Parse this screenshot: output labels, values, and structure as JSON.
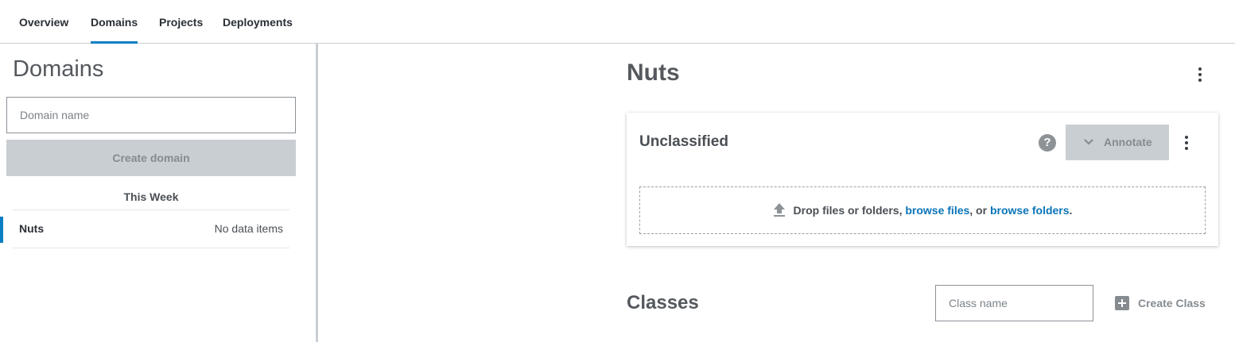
{
  "nav": {
    "tabs": [
      {
        "label": "Overview",
        "active": false
      },
      {
        "label": "Domains",
        "active": true
      },
      {
        "label": "Projects",
        "active": false
      },
      {
        "label": "Deployments",
        "active": false
      }
    ]
  },
  "sidebar": {
    "title": "Domains",
    "domain_input": {
      "placeholder": "Domain name",
      "value": ""
    },
    "create_button_label": "Create domain",
    "group_label": "This Week",
    "domains": [
      {
        "name": "Nuts",
        "meta": "No data items",
        "selected": true
      }
    ]
  },
  "main": {
    "title": "Nuts",
    "unclassified_card": {
      "title": "Unclassified",
      "help_icon_glyph": "?",
      "annotate_label": "Annotate",
      "dropzone": {
        "text_prefix": "Drop files or folders, ",
        "browse_files": "browse files",
        "text_middle": ", or ",
        "browse_folders": "browse folders",
        "text_suffix": "."
      }
    },
    "classes": {
      "title": "Classes",
      "input": {
        "placeholder": "Class name",
        "value": ""
      },
      "create_label": "Create Class"
    }
  },
  "icons": [
    "kebab-menu-icon",
    "help-icon",
    "chevron-down-icon",
    "upload-icon",
    "plus-icon"
  ],
  "colors": {
    "accent": "#0a7ec2",
    "link": "#0a74b8",
    "disabled_button": "#c9ced3",
    "disabled_text": "#868b90"
  }
}
